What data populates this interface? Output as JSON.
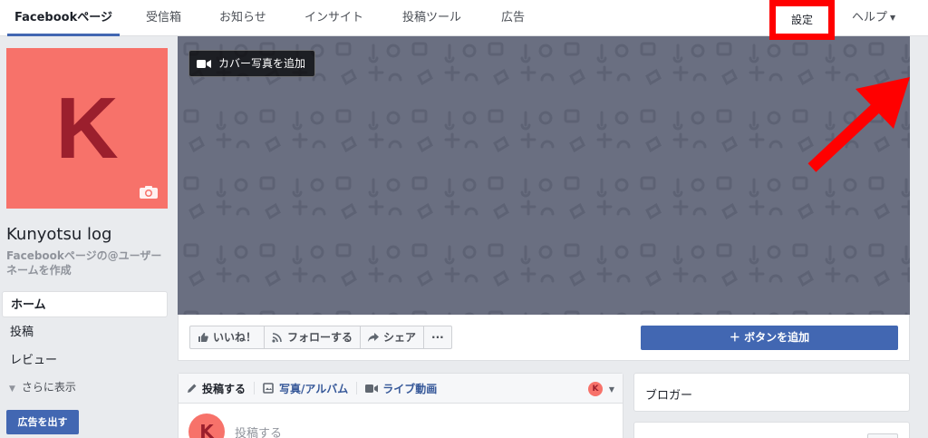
{
  "nav": {
    "tabs": [
      "Facebookページ",
      "受信箱",
      "お知らせ",
      "インサイト",
      "投稿ツール",
      "広告"
    ],
    "settings": "設定",
    "help": "ヘルプ"
  },
  "profile": {
    "letter": "K",
    "name": "Kunyotsu log",
    "username_link": "Facebookページの@ユーザーネームを作成"
  },
  "sidebar": {
    "items": [
      "ホーム",
      "投稿",
      "レビュー"
    ],
    "more": "さらに表示",
    "promote": "広告を出す"
  },
  "cover": {
    "add_cover": "カバー写真を追加"
  },
  "actions": {
    "like": "いいね！",
    "follow": "フォローする",
    "share": "シェア",
    "more": "···",
    "add_button": "＋ ボタンを追加"
  },
  "composer": {
    "tabs": [
      "投稿する",
      "写真/アルバム",
      "ライブ動画"
    ],
    "avatar_letter": "K",
    "placeholder": "投稿する"
  },
  "right": {
    "category": "ブロガー"
  },
  "colors": {
    "brand": "#4267b2",
    "avatar_bg": "#f7726a",
    "avatar_letter": "#9b1f2d",
    "cover": "#6a6f81",
    "highlight": "#ff0000"
  }
}
